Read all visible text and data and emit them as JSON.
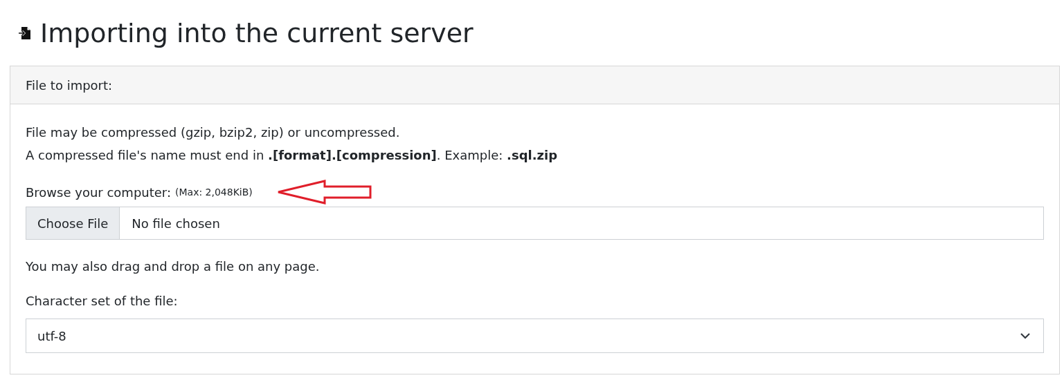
{
  "heading": {
    "title": "Importing into the current server"
  },
  "card": {
    "header": "File to import:",
    "notes": [
      "File may be compressed (gzip, bzip2, zip) or uncompressed.",
      "A compressed file's name must end in **.[format].[compression]**. Example: **.sql.zip**"
    ],
    "browse_label": "Browse your computer:",
    "max_size": "(Max: 2,048KiB)",
    "file_button": "Choose File",
    "file_status": "No file chosen",
    "drag_note": "You may also drag and drop a file on any page.",
    "charset_label": "Character set of the file:",
    "charset_value": "utf-8"
  }
}
